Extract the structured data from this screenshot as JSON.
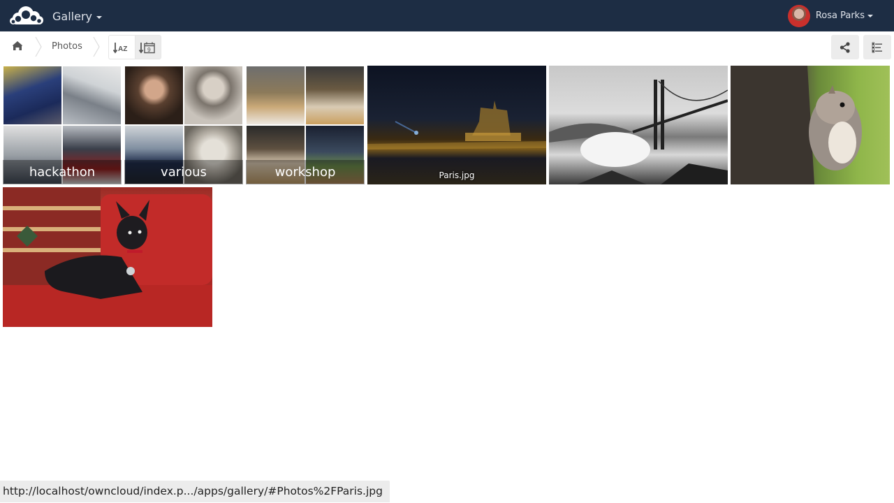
{
  "header": {
    "app_name": "Gallery",
    "user_name": "Rosa Parks",
    "logo_icon": "owncloud-logo-icon",
    "bg_color": "#1d2d44"
  },
  "controls": {
    "breadcrumb": [
      {
        "label": "",
        "icon": "home-icon"
      },
      {
        "label": "Photos"
      }
    ],
    "sort_name_label": "AZ",
    "sort_date_label": "9",
    "share_icon": "share-icon",
    "info_icon": "details-list-icon"
  },
  "albums": [
    {
      "name": "hackathon"
    },
    {
      "name": "various"
    },
    {
      "name": "workshop"
    }
  ],
  "images": [
    {
      "name": "Paris.jpg",
      "label": "Paris.jpg"
    },
    {
      "name": "golden-gate",
      "label": ""
    },
    {
      "name": "squirrel",
      "label": ""
    },
    {
      "name": "dog",
      "label": ""
    }
  ],
  "status_url": "http://localhost/owncloud/index.p.../apps/gallery/#Photos%2FParis.jpg"
}
